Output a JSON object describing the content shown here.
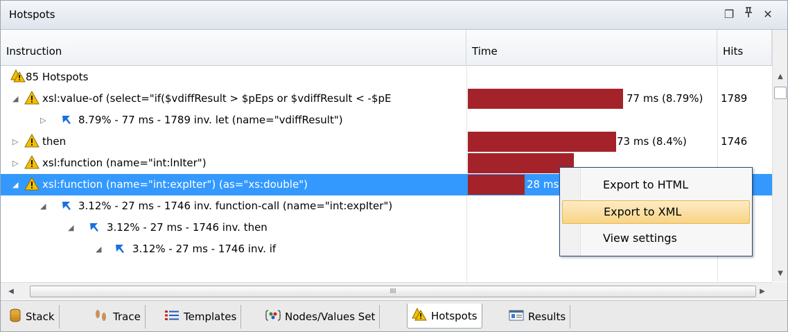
{
  "panel": {
    "title": "Hotspots"
  },
  "window_buttons": [
    {
      "icon": "restore-icon",
      "glyph": "❐"
    },
    {
      "icon": "pin-icon",
      "glyph": "ꟸ"
    },
    {
      "icon": "close-icon",
      "glyph": "✕"
    }
  ],
  "columns": {
    "instruction": "Instruction",
    "time": "Time",
    "hits": "Hits"
  },
  "rows": [
    {
      "text": "85 Hotspots",
      "time": "",
      "hits": ""
    },
    {
      "text": "xsl:value-of (select=\"if($vdiffResult > $pEps or $vdiffResult < -$pE",
      "time": "77 ms (8.79%)",
      "hits": "1789",
      "bar_fraction": 0.879
    },
    {
      "text": "8.79% - 77 ms - 1789 inv. let (name=\"vdiffResult\")",
      "time": "",
      "hits": ""
    },
    {
      "text": "then",
      "time": "73 ms (8.4%)",
      "hits": "1746",
      "bar_fraction": 0.84
    },
    {
      "text": "xsl:function (name=\"int:lnIter\")",
      "time": "",
      "hits": "",
      "bar_fraction": 0.6
    },
    {
      "text": "xsl:function (name=\"int:expIter\") (as=\"xs:double\")",
      "time": "28 ms",
      "hits": "",
      "bar_fraction": 0.32
    },
    {
      "text": "3.12% - 27 ms - 1746 inv. function-call (name=\"int:expIter\")",
      "time": "",
      "hits": ""
    },
    {
      "text": "3.12% - 27 ms - 1746 inv. then",
      "time": "",
      "hits": ""
    },
    {
      "text": "3.12% - 27 ms - 1746 inv. if",
      "time": "",
      "hits": ""
    }
  ],
  "hscroll_grip": "III",
  "context_menu": {
    "items": [
      {
        "label": "Export to HTML"
      },
      {
        "label": "Export to XML"
      },
      {
        "label": "View settings"
      }
    ]
  },
  "tabs": [
    {
      "label": "Stack",
      "icon": "stack-icon"
    },
    {
      "label": "Trace",
      "icon": "trace-icon"
    },
    {
      "label": "Templates",
      "icon": "templates-icon"
    },
    {
      "label": "Nodes/Values Set",
      "icon": "nodes-icon"
    },
    {
      "label": "Hotspots",
      "icon": "hotspots-icon"
    },
    {
      "label": "Results",
      "icon": "results-icon"
    }
  ],
  "colors": {
    "time_bar": "#a4232a",
    "selection": "#3399ff",
    "warning": "#f3c000",
    "call_arrow": "#1a6fe0"
  }
}
